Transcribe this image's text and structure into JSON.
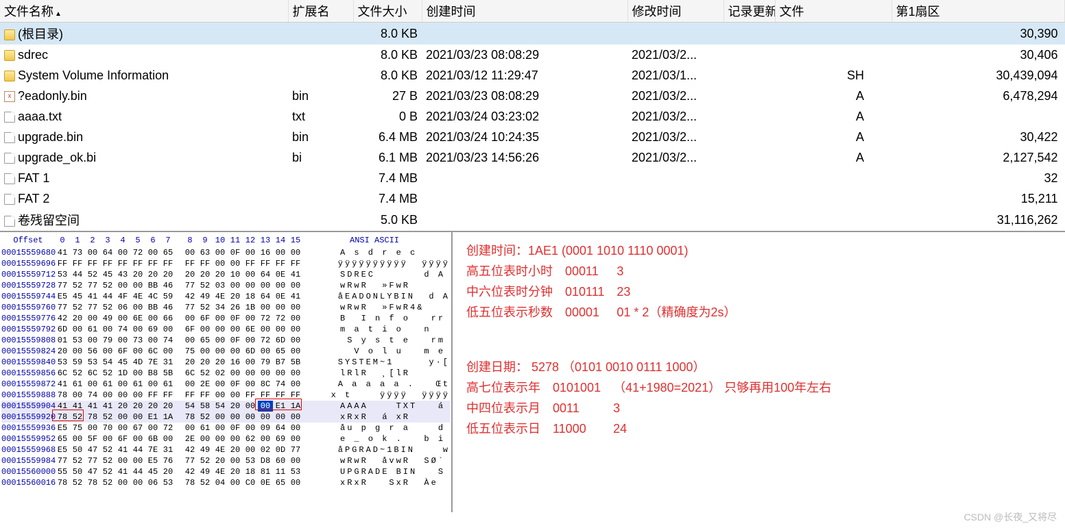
{
  "headers": {
    "name": "文件名称",
    "ext": "扩展名",
    "size": "文件大小",
    "created": "创建时间",
    "modified": "修改时间",
    "record": "记录更新",
    "file": "文件",
    "sector": "第1扇区"
  },
  "rows": [
    {
      "icon": "folder",
      "name": "(根目录)",
      "ext": "",
      "size": "8.0 KB",
      "created": "",
      "modified": "",
      "record": "",
      "file": "",
      "sector": "30,390",
      "selected": true
    },
    {
      "icon": "folder",
      "name": "sdrec",
      "ext": "",
      "size": "8.0 KB",
      "created": "2021/03/23  08:08:29",
      "modified": "2021/03/2...",
      "record": "",
      "file": "",
      "sector": "30,406"
    },
    {
      "icon": "folder",
      "name": "System Volume Information",
      "ext": "",
      "size": "8.0 KB",
      "created": "2021/03/12  11:29:47",
      "modified": "2021/03/1...",
      "record": "",
      "file": "SH",
      "sector": "30,439,094"
    },
    {
      "icon": "x",
      "name": "?eadonly.bin",
      "ext": "bin",
      "size": "27 B",
      "created": "2021/03/23  08:08:29",
      "modified": "2021/03/2...",
      "record": "",
      "file": "A",
      "sector": "6,478,294"
    },
    {
      "icon": "file",
      "name": "aaaa.txt",
      "ext": "txt",
      "size": "0 B",
      "created": "2021/03/24  03:23:02",
      "modified": "2021/03/2...",
      "record": "",
      "file": "A",
      "sector": ""
    },
    {
      "icon": "file",
      "name": "upgrade.bin",
      "ext": "bin",
      "size": "6.4 MB",
      "created": "2021/03/24  10:24:35",
      "modified": "2021/03/2...",
      "record": "",
      "file": "A",
      "sector": "30,422"
    },
    {
      "icon": "file",
      "name": "upgrade_ok.bi",
      "ext": "bi",
      "size": "6.1 MB",
      "created": "2021/03/23  14:56:26",
      "modified": "2021/03/2...",
      "record": "",
      "file": "A",
      "sector": "2,127,542"
    },
    {
      "icon": "file",
      "name": "FAT 1",
      "ext": "",
      "size": "7.4 MB",
      "created": "",
      "modified": "",
      "record": "",
      "file": "",
      "sector": "32"
    },
    {
      "icon": "file",
      "name": "FAT 2",
      "ext": "",
      "size": "7.4 MB",
      "created": "",
      "modified": "",
      "record": "",
      "file": "",
      "sector": "15,211"
    },
    {
      "icon": "file",
      "name": "卷残留空间",
      "ext": "",
      "size": "5.0 KB",
      "created": "",
      "modified": "",
      "record": "",
      "file": "",
      "sector": "31,116,262"
    }
  ],
  "hex": {
    "header_offset": "Offset",
    "header_cols": [
      "0",
      "1",
      "2",
      "3",
      "4",
      "5",
      "6",
      "7",
      "8",
      "9",
      "10",
      "11",
      "12",
      "13",
      "14",
      "15"
    ],
    "header_ascii": "ANSI ASCII",
    "rows": [
      {
        "off": "00015559680",
        "b": [
          "41",
          "73",
          "00",
          "64",
          "00",
          "72",
          "00",
          "65",
          "00",
          "63",
          "00",
          "0F",
          "00",
          "16",
          "00",
          "00"
        ],
        "a": "A s d r e c"
      },
      {
        "off": "00015559696",
        "b": [
          "FF",
          "FF",
          "FF",
          "FF",
          "FF",
          "FF",
          "FF",
          "FF",
          "FF",
          "FF",
          "00",
          "00",
          "FF",
          "FF",
          "FF",
          "FF"
        ],
        "a": "ÿÿÿÿÿÿÿÿÿÿ  ÿÿÿÿ"
      },
      {
        "off": "00015559712",
        "b": [
          "53",
          "44",
          "52",
          "45",
          "43",
          "20",
          "20",
          "20",
          "20",
          "20",
          "20",
          "10",
          "00",
          "64",
          "0E",
          "41"
        ],
        "a": "SDREC       d A"
      },
      {
        "off": "00015559728",
        "b": [
          "77",
          "52",
          "77",
          "52",
          "00",
          "00",
          "BB",
          "46",
          "77",
          "52",
          "03",
          "00",
          "00",
          "00",
          "00",
          "00"
        ],
        "a": "wRwR  »FwR"
      },
      {
        "off": "00015559744",
        "b": [
          "E5",
          "45",
          "41",
          "44",
          "4F",
          "4E",
          "4C",
          "59",
          "42",
          "49",
          "4E",
          "20",
          "18",
          "64",
          "0E",
          "41"
        ],
        "a": "åEADONLYBIN  d A"
      },
      {
        "off": "00015559760",
        "b": [
          "77",
          "52",
          "77",
          "52",
          "06",
          "00",
          "BB",
          "46",
          "77",
          "52",
          "34",
          "26",
          "1B",
          "00",
          "00",
          "00"
        ],
        "a": "wRwR  »FwR4&"
      },
      {
        "off": "00015559776",
        "b": [
          "42",
          "20",
          "00",
          "49",
          "00",
          "6E",
          "00",
          "66",
          "00",
          "6F",
          "00",
          "0F",
          "00",
          "72",
          "72",
          "00"
        ],
        "a": "B  I n f o   rr"
      },
      {
        "off": "00015559792",
        "b": [
          "6D",
          "00",
          "61",
          "00",
          "74",
          "00",
          "69",
          "00",
          "6F",
          "00",
          "00",
          "00",
          "6E",
          "00",
          "00",
          "00"
        ],
        "a": "m a t i o   n"
      },
      {
        "off": "00015559808",
        "b": [
          "01",
          "53",
          "00",
          "79",
          "00",
          "73",
          "00",
          "74",
          "00",
          "65",
          "00",
          "0F",
          "00",
          "72",
          "6D",
          "00"
        ],
        "a": " S y s t e   rm"
      },
      {
        "off": "00015559824",
        "b": [
          "20",
          "00",
          "56",
          "00",
          "6F",
          "00",
          "6C",
          "00",
          "75",
          "00",
          "00",
          "00",
          "6D",
          "00",
          "65",
          "00"
        ],
        "a": "  V o l u   m e"
      },
      {
        "off": "00015559840",
        "b": [
          "53",
          "59",
          "53",
          "54",
          "45",
          "4D",
          "7E",
          "31",
          "20",
          "20",
          "20",
          "16",
          "00",
          "79",
          "B7",
          "5B"
        ],
        "a": "SYSTEM~1     y·["
      },
      {
        "off": "00015559856",
        "b": [
          "6C",
          "52",
          "6C",
          "52",
          "1D",
          "00",
          "B8",
          "5B",
          "6C",
          "52",
          "02",
          "00",
          "00",
          "00",
          "00",
          "00"
        ],
        "a": "lRlR  ¸[lR"
      },
      {
        "off": "00015559872",
        "b": [
          "41",
          "61",
          "00",
          "61",
          "00",
          "61",
          "00",
          "61",
          "00",
          "2E",
          "00",
          "0F",
          "00",
          "8C",
          "74",
          "00"
        ],
        "a": "A a a a a .   Œt"
      },
      {
        "off": "00015559888",
        "b": [
          "78",
          "00",
          "74",
          "00",
          "00",
          "00",
          "FF",
          "FF",
          "FF",
          "FF",
          "00",
          "00",
          "FF",
          "FF",
          "FF",
          "FF"
        ],
        "a": "x t    ÿÿÿÿ  ÿÿÿÿ"
      },
      {
        "off": "00015559904",
        "b": [
          "41",
          "41",
          "41",
          "41",
          "20",
          "20",
          "20",
          "20",
          "54",
          "58",
          "54",
          "20",
          "00",
          "00",
          "E1",
          "1A"
        ],
        "a": "AAAA    TXT   á",
        "hl": true,
        "box_end": true
      },
      {
        "off": "00015559920",
        "b": [
          "78",
          "52",
          "78",
          "52",
          "00",
          "00",
          "E1",
          "1A",
          "78",
          "52",
          "00",
          "00",
          "00",
          "00",
          "00",
          "00"
        ],
        "a": "xRxR  á xR",
        "hl": true,
        "box_start": true
      },
      {
        "off": "00015559936",
        "b": [
          "E5",
          "75",
          "00",
          "70",
          "00",
          "67",
          "00",
          "72",
          "00",
          "61",
          "00",
          "0F",
          "00",
          "09",
          "64",
          "00"
        ],
        "a": "åu p g r a    d"
      },
      {
        "off": "00015559952",
        "b": [
          "65",
          "00",
          "5F",
          "00",
          "6F",
          "00",
          "6B",
          "00",
          "2E",
          "00",
          "00",
          "00",
          "62",
          "00",
          "69",
          "00"
        ],
        "a": "e _ o k .   b i"
      },
      {
        "off": "00015559968",
        "b": [
          "E5",
          "50",
          "47",
          "52",
          "41",
          "44",
          "7E",
          "31",
          "42",
          "49",
          "4E",
          "20",
          "00",
          "02",
          "0D",
          "77"
        ],
        "a": "åPGRAD~1BIN    w"
      },
      {
        "off": "00015559984",
        "b": [
          "77",
          "52",
          "77",
          "52",
          "00",
          "00",
          "E5",
          "76",
          "77",
          "52",
          "20",
          "00",
          "53",
          "D8",
          "60",
          "00"
        ],
        "a": "wRwR  åvwR  SØ`"
      },
      {
        "off": "00015560000",
        "b": [
          "55",
          "50",
          "47",
          "52",
          "41",
          "44",
          "45",
          "20",
          "42",
          "49",
          "4E",
          "20",
          "18",
          "81",
          "11",
          "53"
        ],
        "a": "UPGRADE BIN   S"
      },
      {
        "off": "00015560016",
        "b": [
          "78",
          "52",
          "78",
          "52",
          "00",
          "00",
          "06",
          "53",
          "78",
          "52",
          "04",
          "00",
          "C0",
          "0E",
          "65",
          "00"
        ],
        "a": "xRxR   SxR  Àe"
      }
    ]
  },
  "annotations": {
    "time_title": "创建时间：1AE1 (0001 1010 1110 0001)",
    "time_rows": [
      {
        "label": "高五位表时小时",
        "bits": "00011",
        "val": "3"
      },
      {
        "label": "中六位表时分钟",
        "bits": "010111",
        "val": "23"
      },
      {
        "label": "低五位表示秒数",
        "bits": "00001",
        "val": "01 * 2（精确度为2s）"
      }
    ],
    "date_title": "创建日期： 5278  （0101 0010 0111 1000）",
    "date_rows": [
      {
        "label": "高七位表示年",
        "bits": "0101001",
        "val": "（41+1980=2021）  只够再用100年左右"
      },
      {
        "label": "中四位表示月",
        "bits": "0011",
        "val": "3"
      },
      {
        "label": "低五位表示日",
        "bits": "11000",
        "val": "24"
      }
    ]
  },
  "watermark": "CSDN @长夜_又将尽"
}
